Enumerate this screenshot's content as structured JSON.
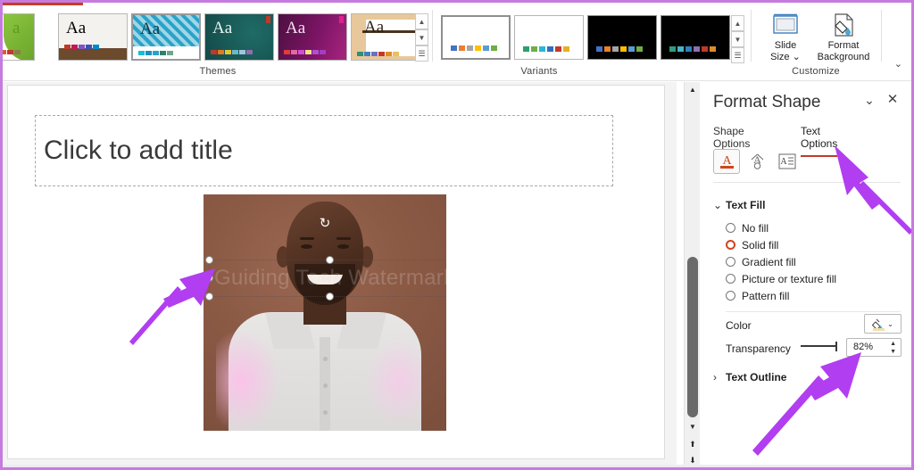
{
  "app": {
    "accent_red": "#c0392b",
    "annotation_purple": "#b13ef0"
  },
  "ribbon": {
    "groups": [
      {
        "name": "Themes",
        "label": "Themes"
      },
      {
        "name": "Variants",
        "label": "Variants"
      },
      {
        "name": "Customize",
        "label": "Customize"
      }
    ],
    "themes": [
      {
        "aa": "a",
        "name": "theme-facet"
      },
      {
        "aa": "Aa",
        "name": "theme-wood-type"
      },
      {
        "aa": "Aa",
        "name": "theme-damask"
      },
      {
        "aa": "Aa",
        "name": "theme-teal-circuit"
      },
      {
        "aa": "Aa",
        "name": "theme-berlin"
      },
      {
        "aa": "Aa",
        "name": "theme-wisp"
      }
    ],
    "gallery_scroll": {
      "up": "▲",
      "down": "▼",
      "more": "☰"
    },
    "variants": [
      {
        "name": "variant-light-1"
      },
      {
        "name": "variant-light-2"
      },
      {
        "name": "variant-dark-1"
      },
      {
        "name": "variant-dark-2"
      }
    ],
    "customize": [
      {
        "label_line1": "Slide",
        "label_line2": "Size ⌄",
        "icon": "slide-size-icon"
      },
      {
        "label_line1": "Format",
        "label_line2": "Background",
        "icon": "format-background-icon"
      }
    ],
    "expand_icon": "⌄"
  },
  "slide": {
    "title_placeholder": "Click to add title",
    "watermark_text": "Guiding Tech Watermark",
    "rotate_handle_icon": "↻"
  },
  "scrollbar": {
    "up": "▲",
    "down": "▼",
    "prev_slide": "⬆",
    "next_slide": "⬇"
  },
  "pane": {
    "title": "Format Shape",
    "collapse_icon": "⌄",
    "close_icon": "✕",
    "tabs": [
      {
        "label": "Shape Options",
        "active": false
      },
      {
        "label": "Text Options",
        "active": true
      }
    ],
    "icon_buttons": [
      {
        "name": "text-fill-and-outline-icon",
        "glyph": "A",
        "active": true
      },
      {
        "name": "text-effects-icon",
        "glyph": "A",
        "active": false
      },
      {
        "name": "textbox-icon",
        "glyph": "A",
        "active": false
      }
    ],
    "text_fill": {
      "section_label": "Text Fill",
      "chevron": "⌄",
      "options": [
        {
          "label": "No fill",
          "accel": "N",
          "selected": false
        },
        {
          "label": "Solid fill",
          "accel": "S",
          "selected": true
        },
        {
          "label": "Gradient fill",
          "accel": "G",
          "selected": false
        },
        {
          "label": "Picture or texture fill",
          "accel": "P",
          "selected": false
        },
        {
          "label": "Pattern fill",
          "accel": "a",
          "selected": false
        }
      ],
      "color_label": "Color",
      "color_dropdown_caret": "⌄",
      "transparency_label": "Transparency",
      "transparency_value": "82%",
      "spinner_up": "▲",
      "spinner_down": "▼"
    },
    "text_outline": {
      "section_label": "Text Outline",
      "chevron": "›"
    }
  },
  "annotations": [
    {
      "name": "arrow-to-text-options-tab"
    },
    {
      "name": "arrow-to-watermark-selection"
    },
    {
      "name": "arrow-to-transparency-field"
    }
  ]
}
